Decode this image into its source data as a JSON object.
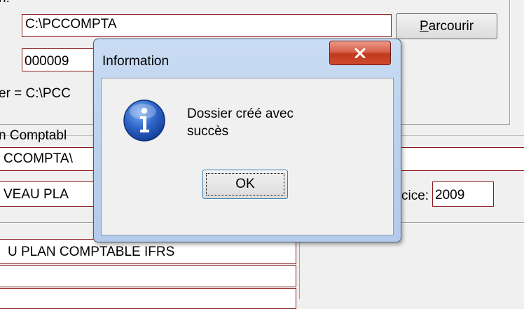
{
  "bg_form": {
    "top_label": "n:",
    "path_field": "C:\\PCCOMPTA",
    "browse_button": "Parcourir",
    "browse_accel": "P",
    "number_field": "000009",
    "folder_text": "er = C:\\PCC",
    "plan_label": "n Comptabl",
    "plan_field": "CCOMPTA\\",
    "plan_name_field": "VEAU PLA",
    "exercise_label": "cice:",
    "exercise_value": "2009",
    "ifrs_field": "U PLAN COMPTABLE IFRS"
  },
  "dialog": {
    "title": "Information",
    "close_label": "X",
    "message_line1": "Dossier créé avec",
    "message_line2": "succès",
    "ok_label": "OK",
    "icon": "info-icon"
  },
  "colors": {
    "field_border": "#8b1a1a",
    "close_red": "#c0391f",
    "title_blue": "#bcd2ee"
  }
}
